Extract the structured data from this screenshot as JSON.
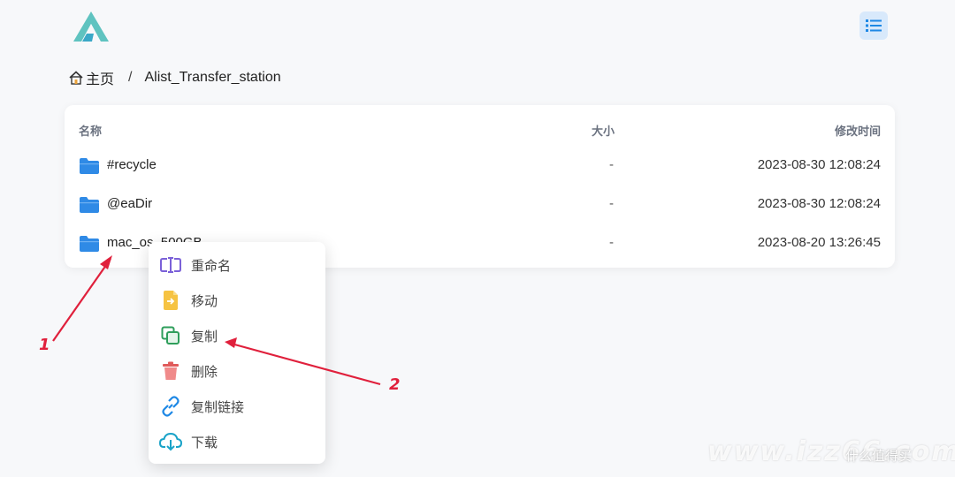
{
  "header": {
    "logo_icon": "alist-logo-icon",
    "menu_icon": "list-icon"
  },
  "breadcrumb": {
    "home_label": "主页",
    "separator": "/",
    "current": "Alist_Transfer_station"
  },
  "table": {
    "columns": {
      "name": "名称",
      "size": "大小",
      "modified": "修改时间"
    },
    "rows": [
      {
        "name": "#recycle",
        "size": "-",
        "modified": "2023-08-30 12:08:24"
      },
      {
        "name": "@eaDir",
        "size": "-",
        "modified": "2023-08-30 12:08:24"
      },
      {
        "name": "mac_os_500GB",
        "size": "-",
        "modified": "2023-08-20 13:26:45"
      }
    ]
  },
  "context_menu": {
    "items": [
      {
        "label": "重命名",
        "icon": "rename-icon",
        "color": "#7b61d8"
      },
      {
        "label": "移动",
        "icon": "move-file-icon",
        "color": "#f0a500"
      },
      {
        "label": "复制",
        "icon": "copy-icon",
        "color": "#2e9e5b"
      },
      {
        "label": "删除",
        "icon": "trash-icon",
        "color": "#e05a5a"
      },
      {
        "label": "复制链接",
        "icon": "link-icon",
        "color": "#1e88e5"
      },
      {
        "label": "下载",
        "icon": "cloud-download-icon",
        "color": "#1aa3c8"
      }
    ]
  },
  "annotations": {
    "label_1": "1",
    "label_2": "2",
    "color": "#e0203c"
  },
  "watermark": {
    "text": "www.izz66.com",
    "brand": "什么值得买"
  },
  "colors": {
    "folder": "#2f8ae6",
    "accent": "#1e88e5",
    "menu_button_bg": "#d8e9fb"
  }
}
